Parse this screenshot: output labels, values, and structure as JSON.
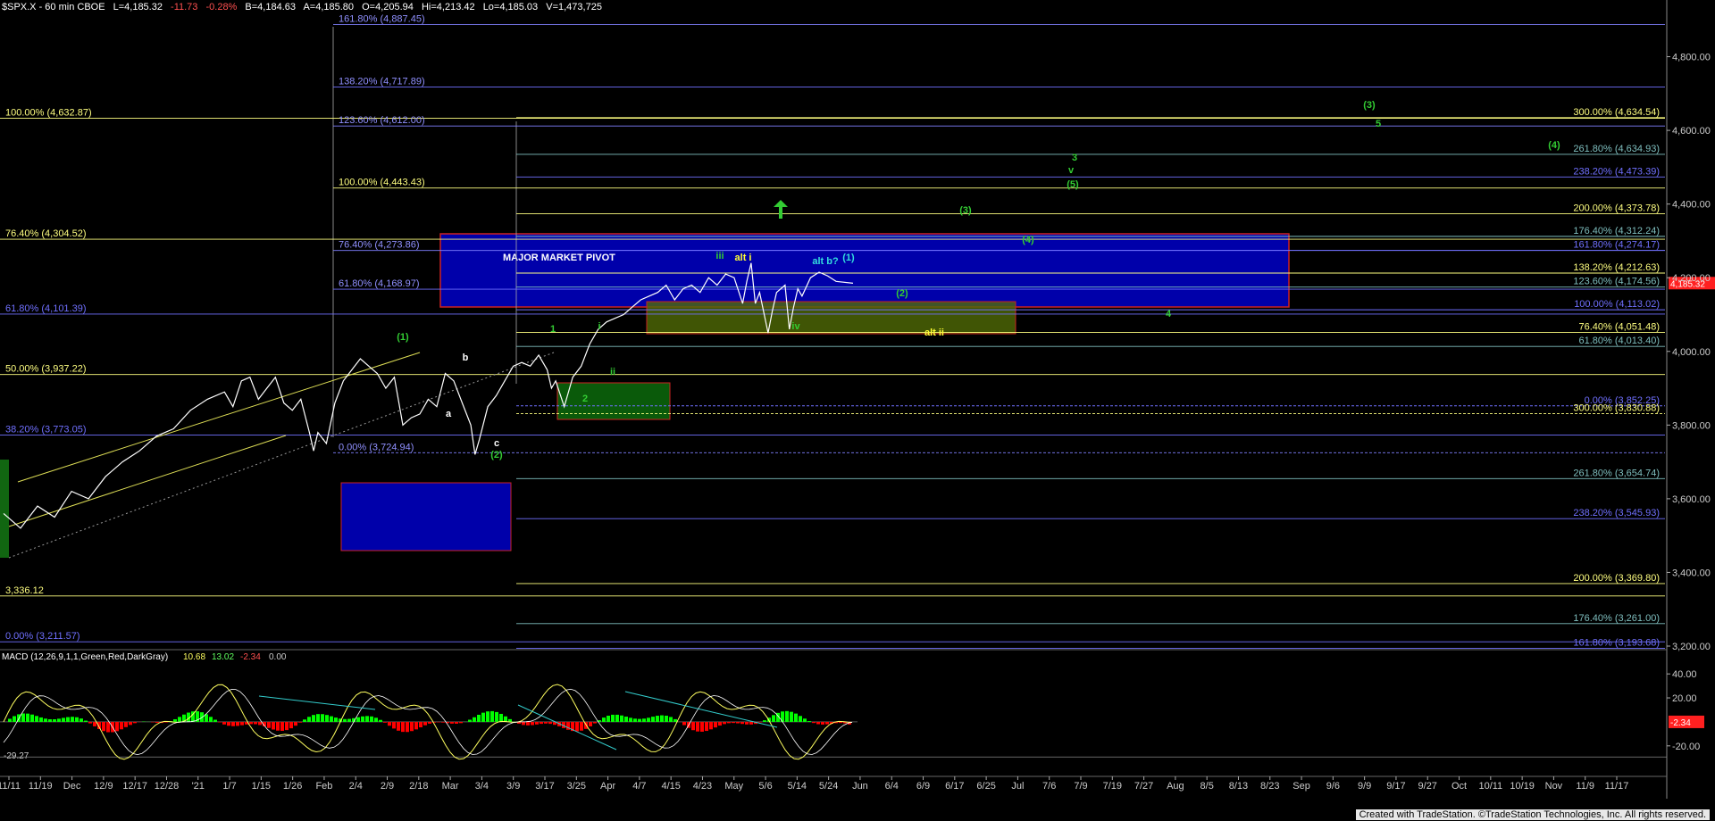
{
  "header": {
    "symbol": "$SPX.X - 60 min  CBOE",
    "last": "L=4,185.32",
    "change": "-11.73",
    "pct": "-0.28%",
    "bid": "B=4,184.63",
    "ask": "A=4,185.80",
    "open": "O=4,205.94",
    "high": "Hi=4,213.42",
    "low": "Lo=4,185.03",
    "volume": "V=1,473,725"
  },
  "footer": "Created with TradeStation. ©TradeStation Technologies, Inc. All rights reserved.",
  "colors": {
    "background": "#000000",
    "price": "#ffffff",
    "fib_blue": "#7070ff",
    "fib_yellow": "#ffff80",
    "wave_green": "#33cc33",
    "wave_yellow": "#ffff33",
    "macd_up": "#00ff00",
    "macd_down": "#ff0000",
    "price_marker": "#ff2020",
    "trend_cyan": "#33cccc"
  },
  "chart_data": {
    "type": "line",
    "title": "",
    "ylim": [
      3200,
      4920
    ],
    "y_ticks": [
      "4,800.00",
      "4,600.00",
      "4,400.00",
      "4,200.00",
      "4,000.00",
      "3,800.00",
      "3,600.00",
      "3,400.00",
      "3,200.00"
    ],
    "y_tick_values": [
      4800,
      4600,
      4400,
      4200,
      4000,
      3800,
      3600,
      3400,
      3200
    ],
    "last_price_label": "4,185.32",
    "x_labels": [
      "11/11",
      "11/19",
      "Dec",
      "12/9",
      "12/17",
      "12/28",
      "'21",
      "1/7",
      "1/15",
      "1/26",
      "Feb",
      "2/4",
      "2/9",
      "2/18",
      "Mar",
      "3/4",
      "3/9",
      "3/17",
      "3/25",
      "Apr",
      "4/7",
      "4/15",
      "4/23",
      "May",
      "5/6",
      "5/14",
      "5/24",
      "Jun",
      "6/4",
      "6/9",
      "6/17",
      "6/25",
      "Jul",
      "7/6",
      "7/9",
      "7/19",
      "7/27",
      "Aug",
      "8/5",
      "8/13",
      "8/23",
      "Sep",
      "9/6",
      "9/9",
      "9/17",
      "9/27",
      "Oct",
      "10/11",
      "10/19",
      "Nov",
      "11/9",
      "11/17"
    ],
    "series": [
      {
        "values": [
          [
            0,
            3560
          ],
          [
            0.02,
            3520
          ],
          [
            0.04,
            3580
          ],
          [
            0.06,
            3550
          ],
          [
            0.08,
            3620
          ],
          [
            0.1,
            3600
          ],
          [
            0.12,
            3660
          ],
          [
            0.14,
            3700
          ],
          [
            0.16,
            3730
          ],
          [
            0.18,
            3770
          ],
          [
            0.2,
            3790
          ],
          [
            0.22,
            3840
          ],
          [
            0.24,
            3870
          ],
          [
            0.26,
            3890
          ],
          [
            0.27,
            3850
          ],
          [
            0.28,
            3920
          ],
          [
            0.29,
            3930
          ],
          [
            0.3,
            3870
          ],
          [
            0.31,
            3900
          ],
          [
            0.32,
            3930
          ],
          [
            0.33,
            3860
          ],
          [
            0.34,
            3840
          ],
          [
            0.35,
            3870
          ],
          [
            0.36,
            3780
          ],
          [
            0.365,
            3730
          ],
          [
            0.37,
            3780
          ],
          [
            0.38,
            3750
          ],
          [
            0.39,
            3860
          ],
          [
            0.4,
            3920
          ],
          [
            0.41,
            3950
          ],
          [
            0.42,
            3980
          ],
          [
            0.43,
            3960
          ],
          [
            0.44,
            3940
          ],
          [
            0.45,
            3900
          ],
          [
            0.46,
            3930
          ],
          [
            0.47,
            3800
          ],
          [
            0.48,
            3820
          ],
          [
            0.49,
            3830
          ],
          [
            0.5,
            3870
          ],
          [
            0.51,
            3850
          ],
          [
            0.52,
            3940
          ],
          [
            0.53,
            3920
          ],
          [
            0.54,
            3860
          ],
          [
            0.55,
            3800
          ],
          [
            0.555,
            3720
          ],
          [
            0.56,
            3760
          ],
          [
            0.57,
            3850
          ],
          [
            0.58,
            3880
          ],
          [
            0.59,
            3920
          ],
          [
            0.6,
            3960
          ],
          [
            0.61,
            3970
          ],
          [
            0.62,
            3960
          ],
          [
            0.63,
            3990
          ],
          [
            0.64,
            3950
          ],
          [
            0.645,
            3900
          ],
          [
            0.65,
            3920
          ],
          [
            0.66,
            3850
          ],
          [
            0.67,
            3930
          ],
          [
            0.68,
            3960
          ],
          [
            0.69,
            4020
          ],
          [
            0.7,
            4060
          ],
          [
            0.71,
            4080
          ],
          [
            0.72,
            4090
          ],
          [
            0.73,
            4100
          ],
          [
            0.74,
            4120
          ],
          [
            0.75,
            4140
          ],
          [
            0.76,
            4150
          ],
          [
            0.77,
            4160
          ],
          [
            0.78,
            4180
          ],
          [
            0.79,
            4140
          ],
          [
            0.8,
            4170
          ],
          [
            0.81,
            4180
          ],
          [
            0.82,
            4160
          ],
          [
            0.83,
            4200
          ],
          [
            0.84,
            4180
          ],
          [
            0.85,
            4210
          ],
          [
            0.86,
            4200
          ],
          [
            0.87,
            4130
          ],
          [
            0.875,
            4190
          ],
          [
            0.88,
            4240
          ],
          [
            0.885,
            4130
          ],
          [
            0.89,
            4160
          ],
          [
            0.9,
            4050
          ],
          [
            0.905,
            4110
          ],
          [
            0.91,
            4160
          ],
          [
            0.92,
            4180
          ],
          [
            0.925,
            4060
          ],
          [
            0.93,
            4120
          ],
          [
            0.935,
            4170
          ],
          [
            0.94,
            4150
          ],
          [
            0.95,
            4200
          ],
          [
            0.96,
            4215
          ],
          [
            0.97,
            4205
          ],
          [
            0.98,
            4190
          ],
          [
            1,
            4185
          ]
        ]
      }
    ],
    "macd": {
      "label": "MACD (12,26,9,1,1,Green,Red,DarkGray)",
      "values": [
        "10.68",
        "13.02",
        "-2.34",
        "0.00"
      ],
      "ticks": [
        "40.00",
        "20.00",
        "-20.00"
      ],
      "tick_values": [
        40,
        20,
        -20
      ],
      "left_label": "-29.27",
      "current_label": "-2.34",
      "ylim": [
        -38,
        55
      ]
    },
    "fib_left": [
      {
        "label": "100.00% (4,632.87)",
        "value": 4632.87
      },
      {
        "label": "76.40% (4,304.52)",
        "value": 4304.52
      },
      {
        "label": "61.80% (4,101.39)",
        "value": 4101.39
      },
      {
        "label": "50.00% (3,937.22)",
        "value": 3937.22
      },
      {
        "label": "38.20% (3,773.05)",
        "value": 3773.05
      },
      {
        "label": "3,336.12",
        "value": 3336.12
      },
      {
        "label": "0.00% (3,211.57)",
        "value": 3211.57
      }
    ],
    "fib_mid": [
      {
        "label": "161.80% (4,887.45)",
        "value": 4887.45
      },
      {
        "label": "138.20% (4,717.89)",
        "value": 4717.89
      },
      {
        "label": "123.60% (4,612.00)",
        "value": 4612.0
      },
      {
        "label": "100.00% (4,443.43)",
        "value": 4443.43
      },
      {
        "label": "76.40% (4,273.86)",
        "value": 4273.86
      },
      {
        "label": "61.80% (4,168.97)",
        "value": 4168.97
      },
      {
        "label": "0.00% (3,724.94)",
        "value": 3724.94
      }
    ],
    "fib_right": [
      {
        "label": "300.00% (4,634.54)",
        "value": 4634.54
      },
      {
        "label": "261.80% (4,634.93)",
        "value": 4534.93
      },
      {
        "label": "238.20% (4,473.39)",
        "value": 4473.39
      },
      {
        "label": "200.00% (4,373.78)",
        "value": 4373.78
      },
      {
        "label": "176.40% (4,312.24)",
        "value": 4312.24
      },
      {
        "label": "161.80% (4,274.17)",
        "value": 4274.17
      },
      {
        "label": "138.20% (4,212.63)",
        "value": 4212.63
      },
      {
        "label": "123.60% (4,174.56)",
        "value": 4174.56
      },
      {
        "label": "100.00% (4,113.02)",
        "value": 4113.02
      },
      {
        "label": "76.40% (4,051.48)",
        "value": 4051.48
      },
      {
        "label": "61.80% (4,013.40)",
        "value": 4013.4
      },
      {
        "label": "0.00% (3,852.25)",
        "value": 3852.25
      },
      {
        "label": "300.00% (3,830.88)",
        "value": 3830.88
      },
      {
        "label": "261.80% (3,654.74)",
        "value": 3654.74
      },
      {
        "label": "238.20% (3,545.93)",
        "value": 3545.93
      },
      {
        "label": "200.00% (3,369.80)",
        "value": 3369.8
      },
      {
        "label": "176.40% (3,261.00)",
        "value": 3261.0
      },
      {
        "label": "161.80% (3,193.68)",
        "value": 3193.68
      }
    ],
    "annotations": {
      "pivot": "MAJOR MARKET PIVOT",
      "waves_green": [
        "(1)",
        "(2)",
        "(3)",
        "(4)",
        "(5)",
        "(3)",
        "(4)",
        "(2)",
        "1",
        "ii",
        "iii",
        "iv",
        "i",
        "4",
        "3",
        "v",
        "5",
        "2"
      ],
      "waves_white": [
        "a",
        "b",
        "c"
      ],
      "waves_yellow": [
        "alt i",
        "alt ii"
      ],
      "waves_cyan": [
        "alt b?",
        "(1)"
      ]
    }
  }
}
